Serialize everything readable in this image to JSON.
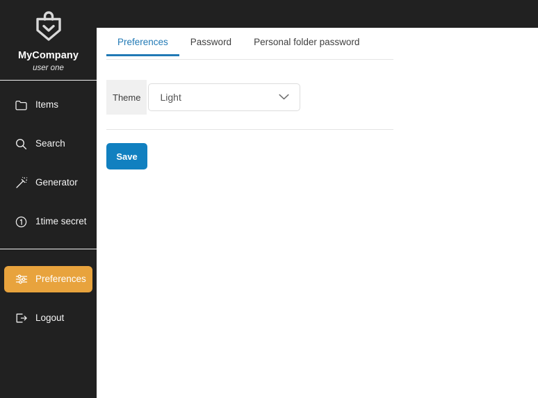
{
  "app": {
    "brand_name": "MyCompany",
    "user_name": "user one",
    "logo_icon": "shield-badge-icon"
  },
  "colors": {
    "sidebar_bg": "#212121",
    "active_nav_bg": "#e8a33d",
    "accent_blue": "#2179b5",
    "save_blue": "#1180c0",
    "label_bg": "#f0f0f0",
    "divider": "#e4e4e4"
  },
  "sidebar": {
    "items": [
      {
        "id": "items",
        "label": "Items",
        "icon": "folder-icon",
        "active": false
      },
      {
        "id": "search",
        "label": "Search",
        "icon": "search-icon",
        "active": false
      },
      {
        "id": "generator",
        "label": "Generator",
        "icon": "magic-wand-icon",
        "active": false
      },
      {
        "id": "onetime",
        "label": "1time secret",
        "icon": "circle-one-icon",
        "active": false
      },
      {
        "id": "prefs",
        "label": "Preferences",
        "icon": "sliders-icon",
        "active": true
      },
      {
        "id": "logout",
        "label": "Logout",
        "icon": "logout-arrow-icon",
        "active": false
      }
    ]
  },
  "main": {
    "tabs": [
      {
        "id": "preferences",
        "label": "Preferences",
        "active": true
      },
      {
        "id": "password",
        "label": "Password",
        "active": false
      },
      {
        "id": "folderpw",
        "label": "Personal folder password",
        "active": false
      }
    ],
    "form": {
      "theme_label": "Theme",
      "theme_value": "Light",
      "theme_options": [
        "Light"
      ],
      "chevron_icon": "chevron-down-icon"
    },
    "save_label": "Save"
  }
}
